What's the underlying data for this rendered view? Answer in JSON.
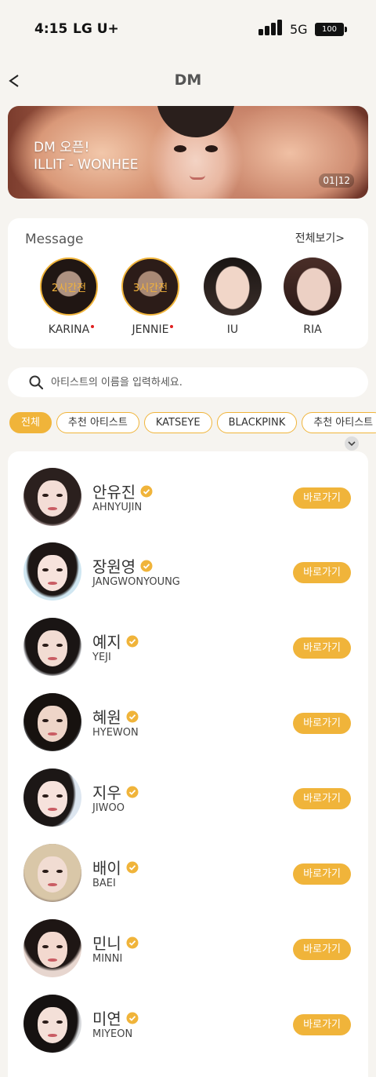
{
  "status_bar": {
    "time": "4:15",
    "carrier": "LG U+",
    "network": "5G",
    "battery": "100"
  },
  "header": {
    "title": "DM"
  },
  "banner": {
    "line1": "DM 오픈!",
    "line2": "ILLIT - WONHEE",
    "counter": "01|12"
  },
  "message": {
    "title": "Message",
    "view_all": "전체보기>",
    "items": [
      {
        "name": "KARINA",
        "tag": "2시간전",
        "unread": true
      },
      {
        "name": "JENNIE",
        "tag": "3시간전",
        "unread": true
      },
      {
        "name": "IU",
        "tag": "",
        "unread": false
      },
      {
        "name": "RIA",
        "tag": "",
        "unread": false
      }
    ]
  },
  "search": {
    "placeholder": "아티스트의 이름을 입력하세요."
  },
  "chips": [
    "전체",
    "추천 아티스트",
    "KATSEYE",
    "BLACKPINK",
    "추천 아티스트"
  ],
  "artists": [
    {
      "name": "안유진",
      "sub": "AHNYUJIN"
    },
    {
      "name": "장원영",
      "sub": "JANGWONYOUNG"
    },
    {
      "name": "예지",
      "sub": "YEJI"
    },
    {
      "name": "혜원",
      "sub": "HYEWON"
    },
    {
      "name": "지우",
      "sub": "JIWOO"
    },
    {
      "name": "배이",
      "sub": "BAEI"
    },
    {
      "name": "민니",
      "sub": "MINNI"
    },
    {
      "name": "미연",
      "sub": "MIYEON"
    }
  ],
  "go_label": "바로가기",
  "colors": {
    "accent": "#f0b43a",
    "background": "#f6f4f0",
    "unread_dot": "#e02020"
  }
}
